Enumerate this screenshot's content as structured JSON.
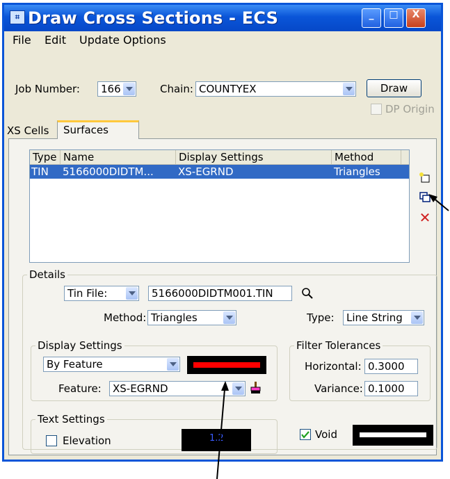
{
  "window": {
    "title": "Draw Cross Sections - ECS",
    "icon": "microstation-app-icon"
  },
  "titlebar_buttons": {
    "minimize": "_",
    "maximize": "□",
    "close": "X"
  },
  "menu": [
    {
      "label": "File"
    },
    {
      "label": "Edit"
    },
    {
      "label": "Update Options"
    }
  ],
  "top": {
    "job_label": "Job Number:",
    "job_value": "166",
    "chain_label": "Chain:",
    "chain_value": "COUNTYEX",
    "draw_label": "Draw",
    "dp_origin_label": "DP Origin"
  },
  "tabs": [
    {
      "label": "XS Cells"
    },
    {
      "label": "Surfaces"
    }
  ],
  "list": {
    "columns": [
      "Type",
      "Name",
      "Display Settings",
      "Method"
    ],
    "rows": [
      {
        "type": "TIN",
        "name": "5166000DIDTM...",
        "display": "XS-EGRND",
        "method": "Triangles"
      }
    ]
  },
  "details": {
    "title": "Details",
    "tin_label": "Tin File:",
    "tin_value": "5166000DIDTM001.TIN",
    "method_label": "Method:",
    "method_value": "Triangles",
    "type_label": "Type:",
    "type_value": "Line String"
  },
  "display_settings": {
    "title": "Display Settings",
    "mode_value": "By Feature",
    "feature_label": "Feature:",
    "feature_value": "XS-EGRND",
    "line_color": "#ff0000"
  },
  "filter": {
    "title": "Filter Tolerances",
    "horizontal_label": "Horizontal:",
    "horizontal_value": "0.3000",
    "variance_label": "Variance:",
    "variance_value": "0.1000"
  },
  "text_settings": {
    "title": "Text Settings",
    "elevation_label": "Elevation",
    "preview_text": "1.2"
  },
  "void": {
    "label": "Void",
    "checked": true
  }
}
